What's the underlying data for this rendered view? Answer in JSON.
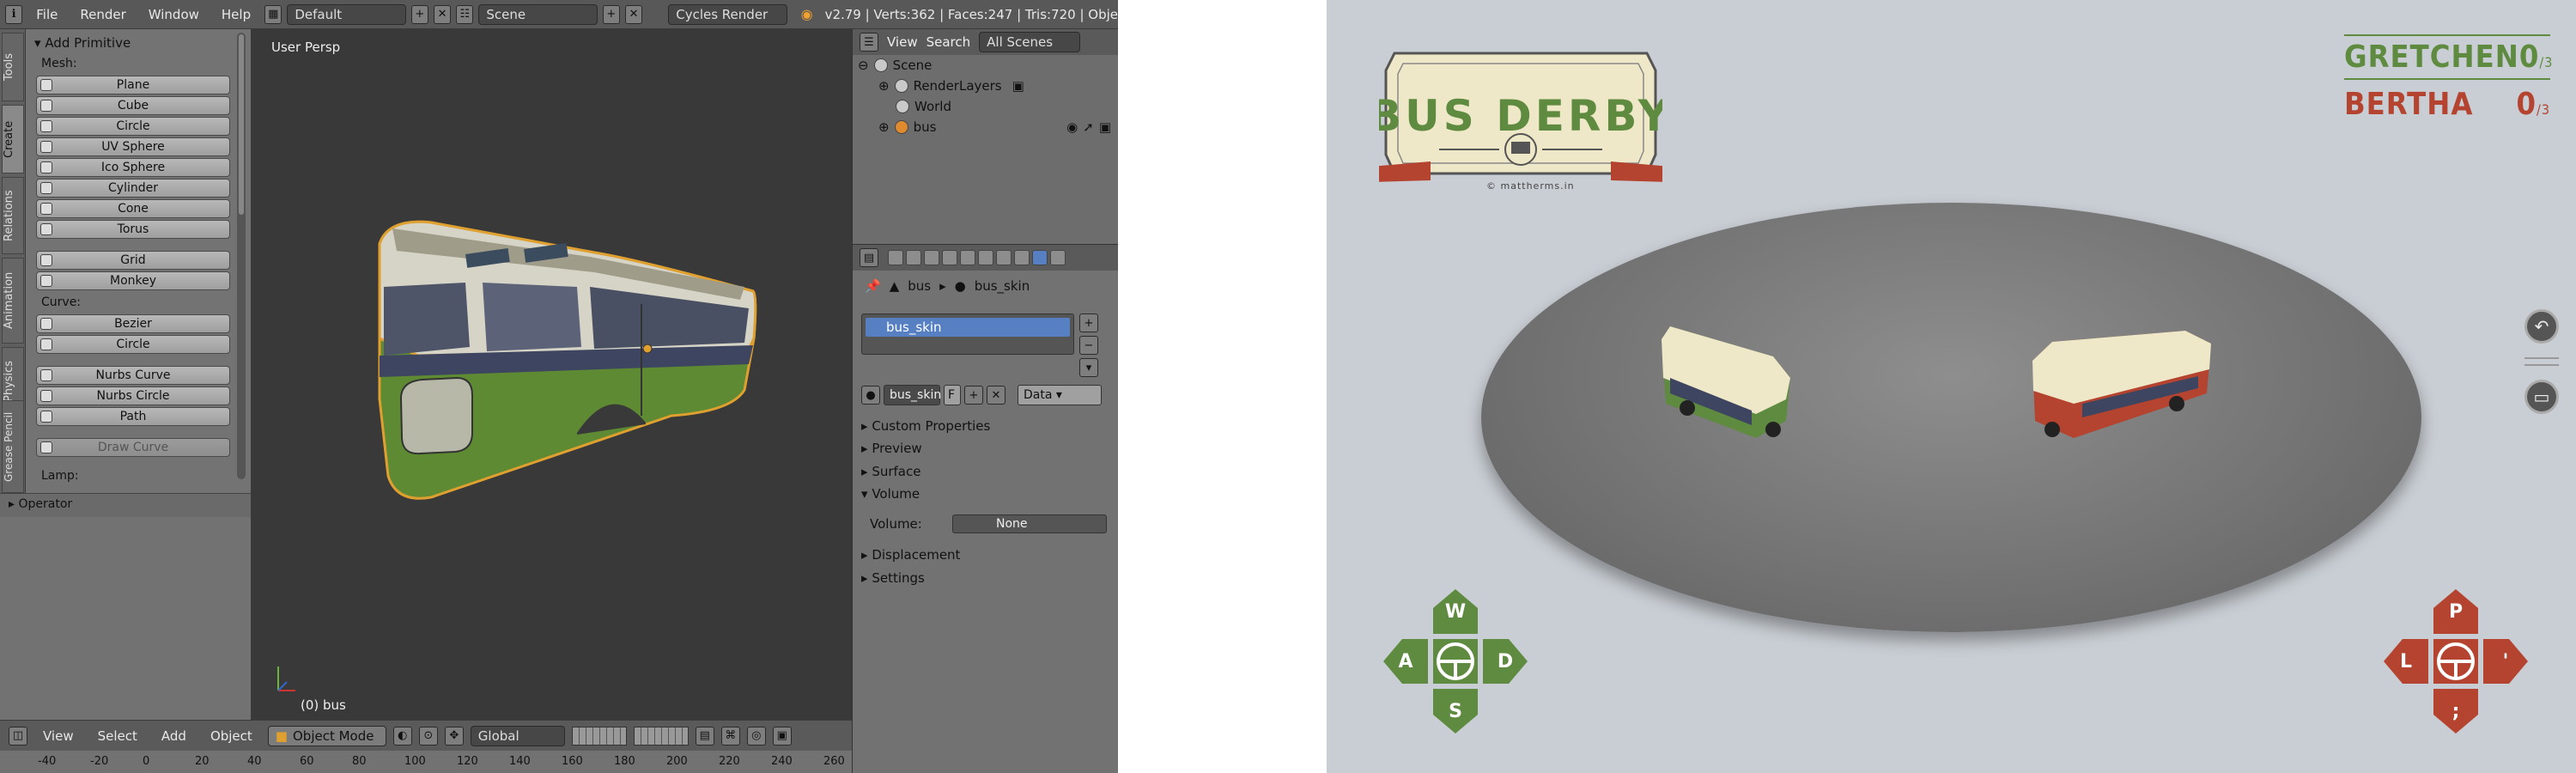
{
  "blender": {
    "menus": [
      "File",
      "Render",
      "Window",
      "Help"
    ],
    "layout": "Default",
    "scene": "Scene",
    "engine": "Cycles Render",
    "stats": "v2.79 | Verts:362 | Faces:247 | Tris:720 | Obje",
    "tabs": [
      "Tools",
      "Create",
      "Relations",
      "Animation",
      "Physics",
      "Grease Pencil"
    ],
    "panel_title": "Add Primitive",
    "mesh_label": "Mesh:",
    "mesh_items": [
      "Plane",
      "Cube",
      "Circle",
      "UV Sphere",
      "Ico Sphere",
      "Cylinder",
      "Cone",
      "Torus"
    ],
    "mesh_items2": [
      "Grid",
      "Monkey"
    ],
    "curve_label": "Curve:",
    "curve_items": [
      "Bezier",
      "Circle"
    ],
    "curve_items2": [
      "Nurbs Curve",
      "Nurbs Circle",
      "Path"
    ],
    "draw_curve": "Draw Curve",
    "lamp_label": "Lamp:",
    "operator": "Operator",
    "viewport_label": "User Persp",
    "object_label": "(0) bus",
    "vp_menus": [
      "View",
      "Select",
      "Add",
      "Object"
    ],
    "mode": "Object Mode",
    "orientation": "Global",
    "ruler": [
      "-40",
      "-20",
      "0",
      "20",
      "40",
      "60",
      "80",
      "100",
      "120",
      "140",
      "160",
      "180",
      "200",
      "220",
      "240",
      "260"
    ],
    "outliner": {
      "menus": [
        "View",
        "Search"
      ],
      "filter": "All Scenes",
      "rows": [
        "Scene",
        "RenderLayers",
        "World",
        "bus"
      ]
    },
    "properties": {
      "crumb_obj": "bus",
      "crumb_mat": "bus_skin",
      "slot": "bus_skin",
      "material_name": "bus_skin",
      "fake_user": "F",
      "link": "Data",
      "panels": [
        "Custom Properties",
        "Preview",
        "Surface",
        "Volume",
        "Displacement",
        "Settings"
      ],
      "volume_label": "Volume:",
      "volume_value": "None"
    }
  },
  "game": {
    "logo_title": "BUS DERBY",
    "credit": "© mattherms.in",
    "players": [
      {
        "name": "GRETCHEN",
        "score": "0",
        "max": "/3",
        "color": "#5e8b3f"
      },
      {
        "name": "BERTHA",
        "score": "0",
        "max": "/3",
        "color": "#b4432f"
      }
    ],
    "left_keys": {
      "up": "W",
      "left": "A",
      "right": "D",
      "down": "S"
    },
    "right_keys": {
      "up": "P",
      "left": "L",
      "right": "'",
      "down": ";"
    },
    "colors": {
      "green": "#5e8b3f",
      "red": "#b4432f",
      "cream": "#efe8c8"
    }
  }
}
